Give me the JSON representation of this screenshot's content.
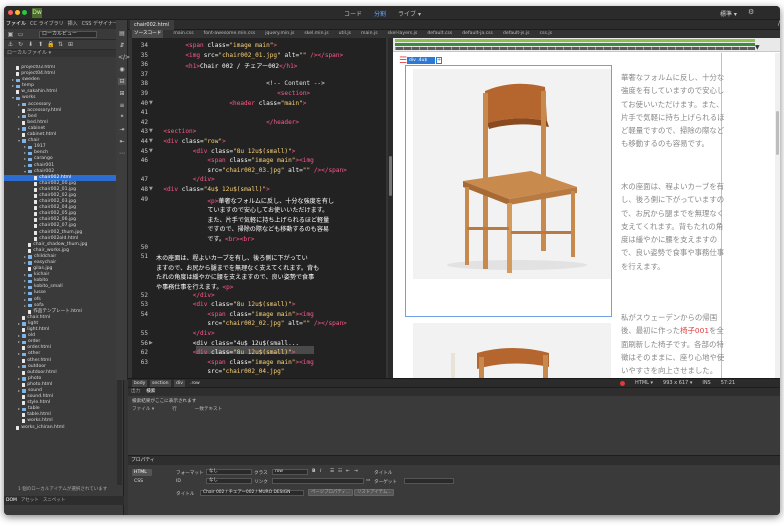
{
  "topbar": {
    "app_logo": "Dw",
    "modes": [
      "コード",
      "分割",
      "ライブ ▾"
    ],
    "active_mode_index": 1,
    "workspace": "標準 ▾"
  },
  "left_panel": {
    "tabs": [
      "ファイル",
      "CC ライブラリ",
      "挿入",
      "CSS デザイナー"
    ],
    "site_select": "ローカルビュー",
    "local_files_header": "ローカルファイル ▾",
    "files": [
      {
        "name": "project03.html",
        "type": "file",
        "depth": 1
      },
      {
        "name": "project04.html",
        "type": "file",
        "depth": 1
      },
      {
        "name": "sweden",
        "type": "folder",
        "depth": 1
      },
      {
        "name": "temp",
        "type": "folder",
        "depth": 1
      },
      {
        "name": "w_sakahin.html",
        "type": "file",
        "depth": 1
      },
      {
        "name": "works",
        "type": "folder",
        "depth": 1,
        "open": true
      },
      {
        "name": "accessory",
        "type": "folder",
        "depth": 2
      },
      {
        "name": "accessory.html",
        "type": "file",
        "depth": 2
      },
      {
        "name": "bed",
        "type": "folder",
        "depth": 2
      },
      {
        "name": "bed.html",
        "type": "file",
        "depth": 2
      },
      {
        "name": "cabinet",
        "type": "folder",
        "depth": 2
      },
      {
        "name": "cabinet.html",
        "type": "file",
        "depth": 2
      },
      {
        "name": "chair",
        "type": "folder",
        "depth": 2,
        "open": true
      },
      {
        "name": "1917",
        "type": "folder",
        "depth": 3
      },
      {
        "name": "bench",
        "type": "folder",
        "depth": 3
      },
      {
        "name": "carango",
        "type": "folder",
        "depth": 3
      },
      {
        "name": "chair001",
        "type": "folder",
        "depth": 3
      },
      {
        "name": "chair002",
        "type": "folder",
        "depth": 3,
        "open": true
      },
      {
        "name": "chair002.html",
        "type": "file",
        "depth": 4,
        "selected": true
      },
      {
        "name": "chair002_00.jpg",
        "type": "file",
        "depth": 4
      },
      {
        "name": "chair002_01.jpg",
        "type": "file",
        "depth": 4
      },
      {
        "name": "chair002_02.jpg",
        "type": "file",
        "depth": 4
      },
      {
        "name": "chair002_03.jpg",
        "type": "file",
        "depth": 4
      },
      {
        "name": "chair002_04.jpg",
        "type": "file",
        "depth": 4
      },
      {
        "name": "chair002_05.jpg",
        "type": "file",
        "depth": 4
      },
      {
        "name": "chair002_06.jpg",
        "type": "file",
        "depth": 4
      },
      {
        "name": "chair002_07.jpg",
        "type": "file",
        "depth": 4
      },
      {
        "name": "chair002_thum.jpg",
        "type": "file",
        "depth": 4
      },
      {
        "name": "chair002old.html",
        "type": "file",
        "depth": 4
      },
      {
        "name": "chair_shadow_thum.jpg",
        "type": "file",
        "depth": 3
      },
      {
        "name": "chair_works.jpg",
        "type": "file",
        "depth": 3
      },
      {
        "name": "childchair",
        "type": "folder",
        "depth": 3
      },
      {
        "name": "easychair",
        "type": "folder",
        "depth": 3
      },
      {
        "name": "gilas.jpg",
        "type": "file",
        "depth": 3
      },
      {
        "name": "kichair",
        "type": "folder",
        "depth": 3
      },
      {
        "name": "kobito",
        "type": "folder",
        "depth": 3
      },
      {
        "name": "kobito_small",
        "type": "folder",
        "depth": 3
      },
      {
        "name": "lusse",
        "type": "folder",
        "depth": 3
      },
      {
        "name": "ofs",
        "type": "folder",
        "depth": 3
      },
      {
        "name": "sofa",
        "type": "folder",
        "depth": 3
      },
      {
        "name": "作品テンプレート.html",
        "type": "file",
        "depth": 3
      },
      {
        "name": "chair.html",
        "type": "file",
        "depth": 2
      },
      {
        "name": "light",
        "type": "folder",
        "depth": 2
      },
      {
        "name": "light.html",
        "type": "file",
        "depth": 2
      },
      {
        "name": "old",
        "type": "folder",
        "depth": 2
      },
      {
        "name": "order",
        "type": "folder",
        "depth": 2
      },
      {
        "name": "order.html",
        "type": "file",
        "depth": 2
      },
      {
        "name": "other",
        "type": "folder",
        "depth": 2
      },
      {
        "name": "other.html",
        "type": "file",
        "depth": 2
      },
      {
        "name": "outdoor",
        "type": "folder",
        "depth": 2
      },
      {
        "name": "outdoor.html",
        "type": "file",
        "depth": 2
      },
      {
        "name": "photo",
        "type": "folder",
        "depth": 2
      },
      {
        "name": "photo.html",
        "type": "file",
        "depth": 2
      },
      {
        "name": "sound",
        "type": "folder",
        "depth": 2
      },
      {
        "name": "sound.html",
        "type": "file",
        "depth": 2
      },
      {
        "name": "style.html",
        "type": "file",
        "depth": 2
      },
      {
        "name": "table",
        "type": "folder",
        "depth": 2
      },
      {
        "name": "table.html",
        "type": "file",
        "depth": 2
      },
      {
        "name": "works.html",
        "type": "file",
        "depth": 2
      },
      {
        "name": "works_ichiran.html",
        "type": "file",
        "depth": 1
      }
    ],
    "status": "1 個のローカルアイテムが選択されています",
    "bottom_tabs": [
      "DOM",
      "アセット",
      "スニペット"
    ]
  },
  "document": {
    "tab_label": "chair002.html",
    "path": "/",
    "related_files": [
      "ソースコード",
      "main.css",
      "font-awesome.min.css",
      "jquery.min.js",
      "skel.min.js",
      "util.js",
      "main.js",
      "skel-layers.js",
      "default.css",
      "default-ja.css",
      "default-js.js",
      "css.js"
    ],
    "active_related_index": 0
  },
  "code": {
    "lines": [
      {
        "n": "34",
        "html": "        <span class=\"tag\">&lt;span</span> <span class=\"attr\">class=</span><span class=\"str\">\"image main\"</span><span class=\"tag\">&gt;</span>"
      },
      {
        "n": "35",
        "html": "        <span class=\"tag\">&lt;img</span> <span class=\"attr\">src=</span><span class=\"str\">\"chair002_01.jpg\"</span> <span class=\"attr\">alt=</span><span class=\"str\">\"\"</span> <span class=\"tag\">/&gt;&lt;/span&gt;</span>"
      },
      {
        "n": "36",
        "html": "        <span class=\"tag\">&lt;h1&gt;</span><span class=\"txt\">Chair 002 / チェアー002</span><span class=\"tag\">&lt;/h1&gt;</span>"
      },
      {
        "n": "37",
        "html": ""
      },
      {
        "n": "38",
        "html": "                              <span class=\"cmt\">&lt;!-- Content --&gt;</span>"
      },
      {
        "n": "39",
        "html": "                                 <span class=\"tag\">&lt;section&gt;</span>"
      },
      {
        "n": "40",
        "html": "                    <span class=\"tag\">&lt;header</span> <span class=\"attr\">class=</span><span class=\"str\">\"main\"</span><span class=\"tag\">&gt;</span>"
      },
      {
        "n": "41",
        "html": ""
      },
      {
        "n": "42",
        "html": "                              <span class=\"tag\">&lt;/header&gt;</span>"
      },
      {
        "n": "43",
        "html": "  <span class=\"tag\">&lt;section&gt;</span>"
      },
      {
        "n": "44",
        "html": "  <span class=\"tag\">&lt;div</span> <span class=\"attr\">class=</span><span class=\"str\">\"row\"</span><span class=\"tag\">&gt;</span>"
      },
      {
        "n": "45",
        "html": "          <span class=\"tag\">&lt;div</span> <span class=\"attr\">class=</span><span class=\"str\">\"8u 12u$(small)\"</span><span class=\"tag\">&gt;</span>"
      },
      {
        "n": "46",
        "html": "              <span class=\"tag\">&lt;span</span> <span class=\"attr\">class=</span><span class=\"str\">\"image main\"</span><span class=\"tag\">&gt;&lt;img</span>"
      },
      {
        "n": "",
        "html": "              <span class=\"attr\">src=</span><span class=\"str\">\"chair002_03.jpg\"</span> <span class=\"attr\">alt=</span><span class=\"str\">\"\"</span> <span class=\"tag\">/&gt;&lt;/span&gt;</span>"
      },
      {
        "n": "47",
        "html": "          <span class=\"tag\">&lt;/div&gt;</span>"
      },
      {
        "n": "48",
        "html": "  <span class=\"tag\">&lt;div</span> <span class=\"attr\">class=</span><span class=\"str\">\"4u$ 12u$(small)\"</span><span class=\"tag\">&gt;</span>"
      },
      {
        "n": "49",
        "html": "              <span class=\"tag\">&lt;p&gt;</span><span class=\"txt\">華奢なフォルムに反し、十分な強度を有し</span>"
      },
      {
        "n": "",
        "html": "              <span class=\"txt\">ていますので安心してお使いいただけます。</span>"
      },
      {
        "n": "",
        "html": "              <span class=\"txt\">また、片手で気軽に持ち上げられるほど軽量</span>"
      },
      {
        "n": "",
        "html": "              <span class=\"txt\">ですので、掃除の際なども移動するのも容易</span>"
      },
      {
        "n": "",
        "html": "              <span class=\"txt\">です。</span><span class=\"tag\">&lt;br&gt;&lt;br&gt;</span>"
      },
      {
        "n": "50",
        "html": ""
      },
      {
        "n": "51",
        "html": "<span class=\"txt\">木の座面は、程よいカーブを有し、後ろ側に下がってい</span>"
      },
      {
        "n": "",
        "html": "<span class=\"txt\">ますので、お尻から腿までを無理なく支えてくれます。背も</span>"
      },
      {
        "n": "",
        "html": "<span class=\"txt\">たれの角度は緩やかに腰を支えますので、良い姿勢で食事</span>"
      },
      {
        "n": "",
        "html": "<span class=\"txt\">や事務仕事を行えます。</span><span class=\"tag\">&lt;p&gt;</span>"
      },
      {
        "n": "52",
        "html": "          <span class=\"tag\">&lt;/div&gt;</span>"
      },
      {
        "n": "53",
        "html": "          <span class=\"tag\">&lt;div</span> <span class=\"attr\">class=</span><span class=\"str\">\"8u 12u$(small)\"</span><span class=\"tag\">&gt;</span>"
      },
      {
        "n": "54",
        "html": "              <span class=\"tag\">&lt;span</span> <span class=\"attr\">class=</span><span class=\"str\">\"image main\"</span><span class=\"tag\">&gt;&lt;img</span>"
      },
      {
        "n": "",
        "html": "              <span class=\"attr\">src=</span><span class=\"str\">\"chair002_02.jpg\"</span> <span class=\"attr\">alt=</span><span class=\"str\">\"\"</span> <span class=\"tag\">/&gt;&lt;/span&gt;</span>"
      },
      {
        "n": "55",
        "html": "          <span class=\"tag\">&lt;/div&gt;</span>"
      },
      {
        "n": "56",
        "html": "          <span class=\"attr\">&lt;div class=\"4u$ 12u$(small...</span>"
      },
      {
        "n": "62",
        "html": "          <span class=\"tag\">&lt;div</span> <span class=\"attr\">class=</span><span class=\"str\">\"8u 12u$(small)\"</span><span class=\"tag\">&gt;</span>"
      },
      {
        "n": "63",
        "html": "              <span class=\"tag\">&lt;span</span> <span class=\"attr\">class=</span><span class=\"str\">\"image main\"</span><span class=\"tag\">&gt;&lt;img</span>"
      },
      {
        "n": "",
        "html": "              <span class=\"attr\">src=</span><span class=\"str\">\"chair002_04.jpg\"</span>"
      }
    ]
  },
  "live": {
    "hud_tag": "div .4u$",
    "hud_plus": "+",
    "para1": "華奢なフォルムに反し、十分な強度を有していますので安心してお使いいただけます。また、片手で気軽に持ち上げられるほど軽量ですので、掃除の際なども移動するのも容易です。",
    "para2": "木の座面は、程よいカーブを有し、後ろ側に下がっていますので、お尻から腿までを無理なく支えてくれます。背もたれの角度は緩やかに腰を支えますので、良い姿勢で食事や事務仕事を行えます。",
    "para3_before": "私がスウェーデンからの帰国後、最初に作った",
    "para3_link": "椅子001",
    "para3_after": "を全面刷新した椅子です。各部の特徴はそのままに、座り心地や使いやすさを向上させました。"
  },
  "status": {
    "crumbs": [
      "body",
      "section",
      "div",
      ".row"
    ],
    "lang": "HTML ▾",
    "size": "993 x 617 ▾",
    "mode": "INS",
    "pos": "57:21"
  },
  "output": {
    "tabs": [
      "出力",
      "検索"
    ],
    "message": "検索結果がここに表示されます",
    "cols": [
      "ファイル ▾",
      "行",
      "一致テキスト"
    ]
  },
  "props": {
    "title": "プロパティ",
    "html_btn": "HTML",
    "css_btn": "CSS",
    "format_label": "フォーマット",
    "format_value": "なし",
    "id_label": "ID",
    "id_value": "なし",
    "class_label": "クラス",
    "class_value": "row",
    "link_label": "リンク",
    "bold": "B",
    "italic": "I",
    "title_label": "タイトル",
    "target_label": "ターゲット",
    "doc_title_label": "タイトル",
    "doc_title_value": "Chair 002 / チェアー002 / MURO DESIGN",
    "page_props_btn": "ページプロパティ...",
    "list_item_btn": "リストアイテム...",
    "list_btn": "リストのプロパティ..."
  }
}
